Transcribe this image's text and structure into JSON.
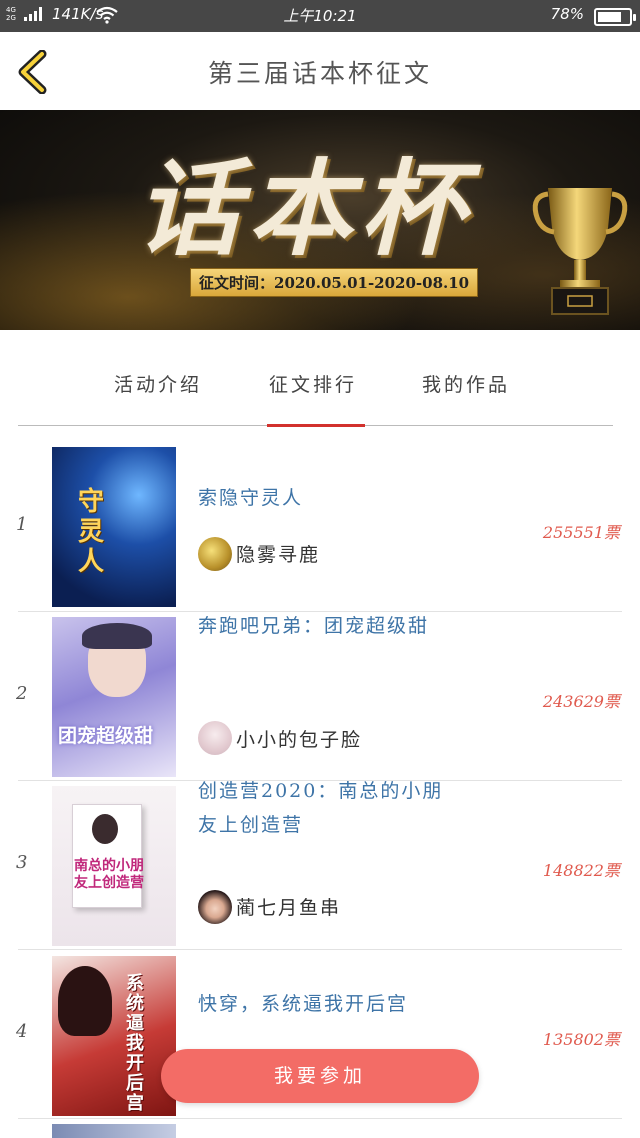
{
  "status_bar": {
    "network_top": "4G",
    "network_bottom": "2G",
    "speed": "141K/s",
    "time": "上午10:21",
    "battery": "78%",
    "battery_level": 0.78
  },
  "header": {
    "title": "第三届话本杯征文"
  },
  "banner": {
    "headline": "话本杯",
    "date_text": "征文时间：2020.05.01-2020-08.10"
  },
  "tabs": [
    {
      "label": "活动介绍"
    },
    {
      "label": "征文排行"
    },
    {
      "label": "我的作品"
    }
  ],
  "selected_tab": "征文排行",
  "rankings": [
    {
      "rank": "1",
      "title": "索隐守灵人",
      "author": "隐雾寻鹿",
      "votes": "255551票",
      "cover_text": "守灵人"
    },
    {
      "rank": "2",
      "title": "奔跑吧兄弟：团宠超级甜",
      "author": "小小的包子脸",
      "votes": "243629票",
      "cover_text": "团宠超级甜"
    },
    {
      "rank": "3",
      "title": "创造营2020：南总的小朋友上创造营",
      "author": "蔺七月鱼串",
      "votes": "148822票",
      "cover_text": "南总的小朋友上创造营"
    },
    {
      "rank": "4",
      "title": "快穿，系统逼我开后宫",
      "author": "",
      "votes": "135802票",
      "cover_text": "系统逼我开后宫"
    }
  ],
  "join_button": {
    "label": "我要参加"
  },
  "colors": {
    "accent": "#d2312d",
    "title_blue": "#3e74a7",
    "votes_red": "#e05a4e",
    "button": "#f36c66"
  }
}
